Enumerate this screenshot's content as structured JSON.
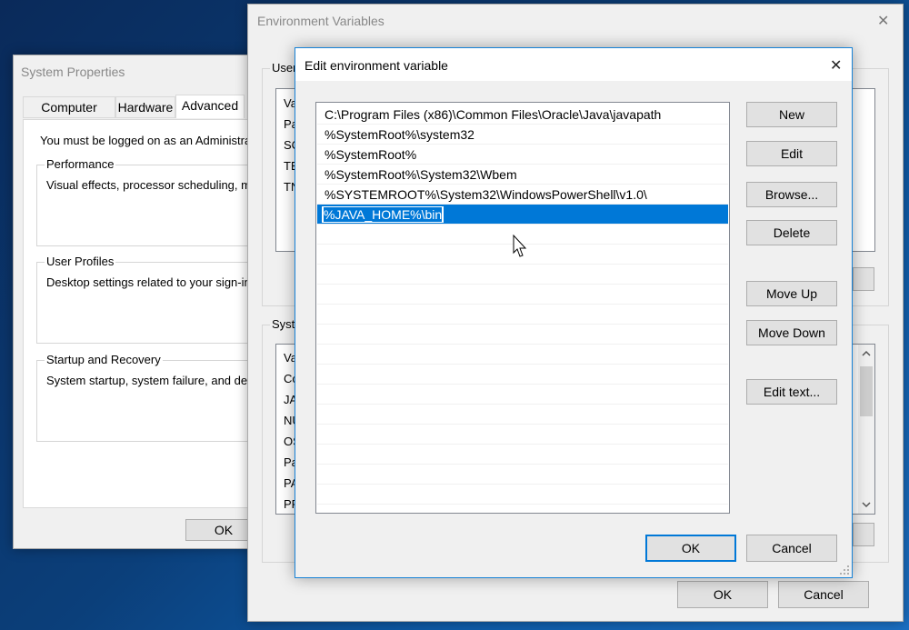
{
  "system_properties": {
    "title": "System Properties",
    "tabs": [
      {
        "label": "Computer Name"
      },
      {
        "label": "Hardware"
      },
      {
        "label": "Advanced"
      }
    ],
    "admin_note": "You must be logged on as an Administrato",
    "performance": {
      "label": "Performance",
      "desc": "Visual effects, processor scheduling, mer"
    },
    "user_profiles": {
      "label": "User Profiles",
      "desc": "Desktop settings related to your sign-in"
    },
    "startup": {
      "label": "Startup and Recovery",
      "desc": "System startup, system failure, and debug"
    },
    "ok_label": "OK"
  },
  "env_vars": {
    "title": "Environment Variables",
    "close_glyph": "✕",
    "user_group_label": "User",
    "user_list_partial": [
      "Va",
      "Pa",
      "SC",
      "TE",
      "TN"
    ],
    "system_group_label": "Syste",
    "system_list_partial": [
      "Va",
      "Co",
      "JA",
      "NU",
      "OS",
      "Pa",
      "PA",
      "PR"
    ],
    "ok_label": "OK",
    "cancel_label": "Cancel"
  },
  "edit_dialog": {
    "title": "Edit environment variable",
    "close_glyph": "✕",
    "paths": [
      "C:\\Program Files (x86)\\Common Files\\Oracle\\Java\\javapath",
      "%SystemRoot%\\system32",
      "%SystemRoot%",
      "%SystemRoot%\\System32\\Wbem",
      "%SYSTEMROOT%\\System32\\WindowsPowerShell\\v1.0\\"
    ],
    "editing_value": "%JAVA_HOME%\\bin",
    "buttons": {
      "new": "New",
      "edit": "Edit",
      "browse": "Browse...",
      "delete": "Delete",
      "move_up": "Move Up",
      "move_down": "Move Down",
      "edit_text": "Edit text..."
    },
    "ok_label": "OK",
    "cancel_label": "Cancel"
  },
  "colors": {
    "accent": "#0078d7",
    "window_bg": "#f0f0f0",
    "desktop": "#0b3f7a"
  }
}
